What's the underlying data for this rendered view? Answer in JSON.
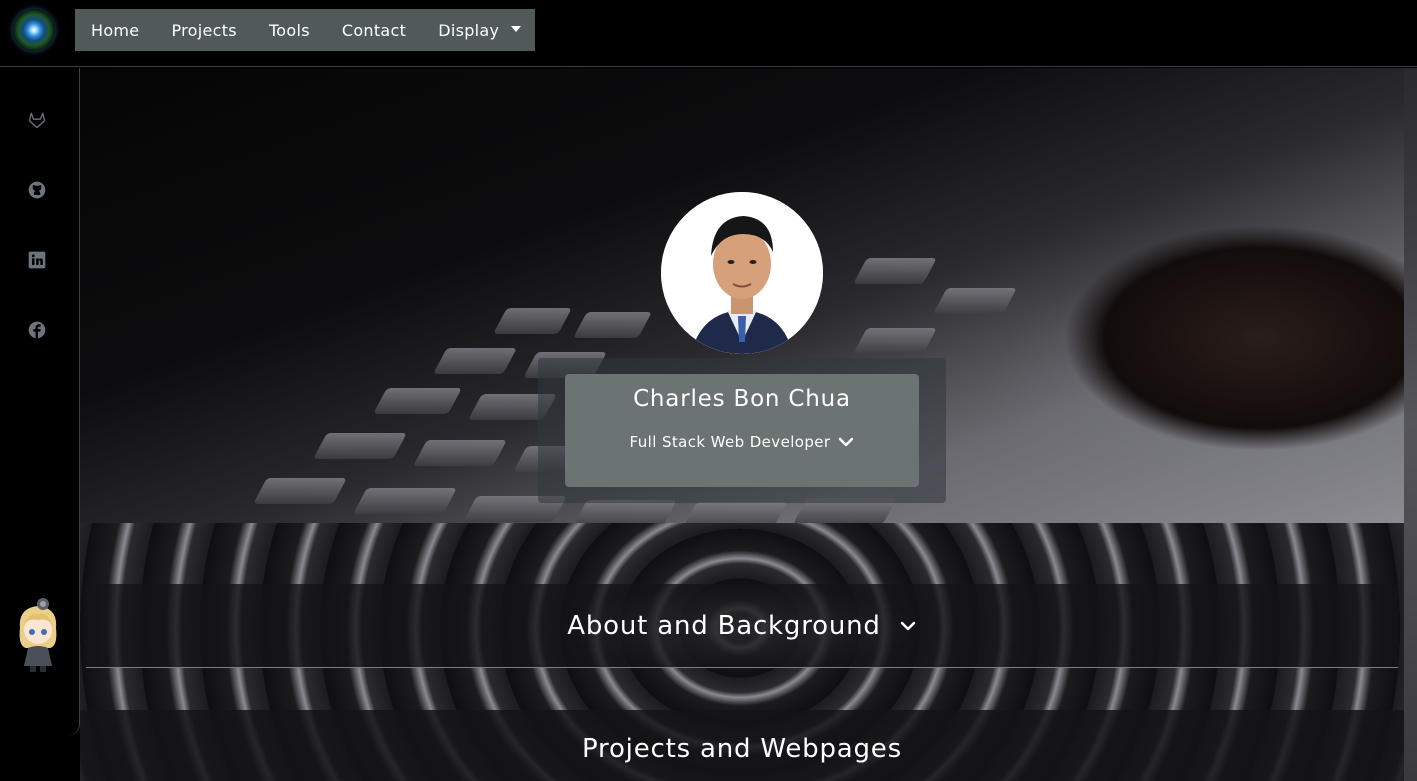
{
  "nav": {
    "links": [
      "Home",
      "Projects",
      "Tools",
      "Contact"
    ],
    "dropdown_label": "Display"
  },
  "sidebar": {
    "icons": [
      "gitlab-icon",
      "github-icon",
      "linkedin-icon",
      "facebook-icon"
    ]
  },
  "profile": {
    "name": "Charles Bon Chua",
    "title": "Full Stack Web Developer"
  },
  "sections": {
    "about": "About and Background",
    "projects": "Projects and Webpages"
  },
  "colors": {
    "nav_bg": "#505a58",
    "card_bg": "#6b7472"
  }
}
